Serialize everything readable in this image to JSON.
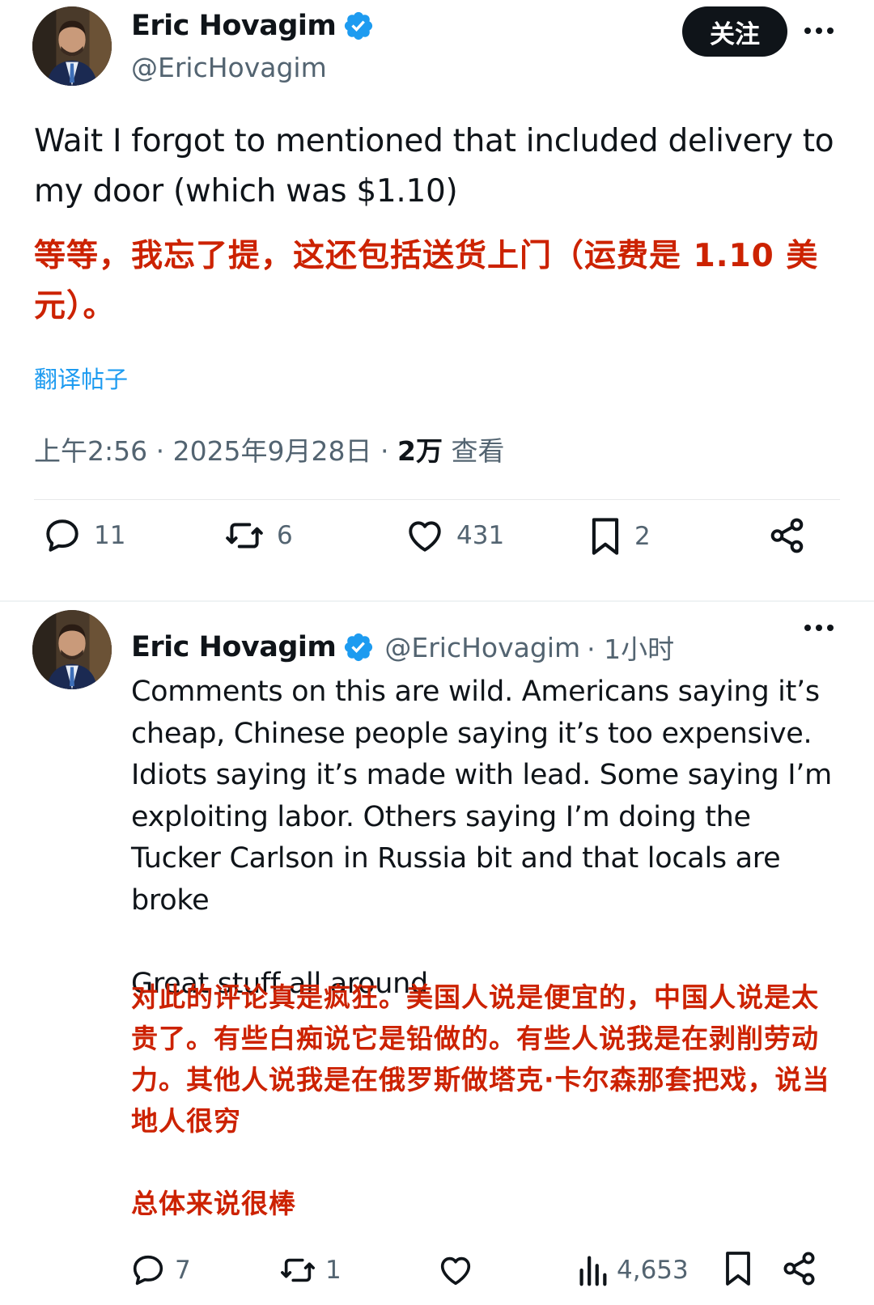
{
  "main_tweet": {
    "author_name": "Eric Hovagim",
    "author_handle": "@EricHovagim",
    "follow_label": "关注",
    "text_en": "Wait I forgot to mentioned that included delivery to my door (which was $1.10)",
    "text_cn": "等等，我忘了提，这还包括送货上门（运费是 1.10 美元）。",
    "translate_label": "翻译帖子",
    "timestamp": "上午2:56 · 2025年9月28日 · ",
    "views_count": "2万",
    "views_label": " 查看",
    "actions": {
      "replies": "11",
      "reposts": "6",
      "likes": "431",
      "bookmarks": "2"
    }
  },
  "reply_tweet": {
    "author_name": "Eric Hovagim",
    "author_handle": "@EricHovagim",
    "time_ago": "· 1小时",
    "text_en": "Comments on this are wild. Americans saying it’s cheap, Chinese people saying it’s too expensive. Idiots saying it’s made with lead. Some saying I’m exploiting labor. Others saying I’m doing the Tucker Carlson in Russia bit and that locals are broke\n\nGreat stuff all around",
    "text_cn": "对此的评论真是疯狂。美国人说是便宜的，中国人说是太贵了。有些白痴说它是铅做的。有些人说我是在剥削劳动力。其他人说我是在俄罗斯做塔克·卡尔森那套把戏，说当地人很穷\n\n总体来说很棒",
    "actions": {
      "replies": "7",
      "reposts": "1",
      "likes": "",
      "views": "4,653"
    }
  },
  "colors": {
    "verified_blue": "#1d9bf0",
    "translation_red": "#cc2200",
    "secondary_text": "#536471"
  }
}
